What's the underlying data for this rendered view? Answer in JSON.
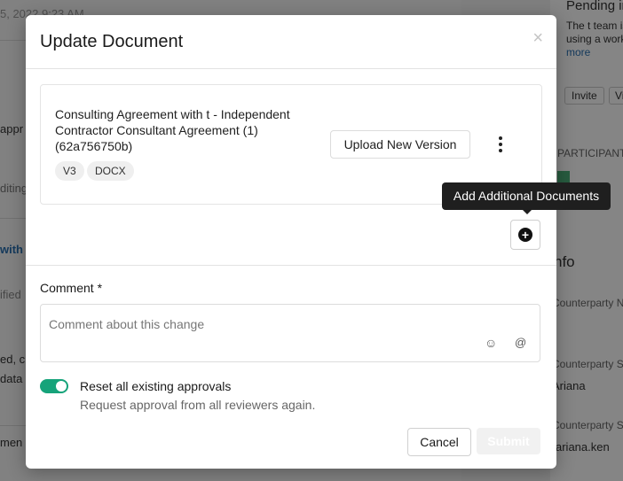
{
  "background": {
    "date_text": "5, 2022 9:23 AM",
    "left_snippets": [
      "appr",
      "diting",
      "with t",
      "ified",
      "ed, cl",
      "data",
      "men"
    ],
    "right_title": "Pending in",
    "right_desc_1": "The t team is",
    "right_desc_2": "using a work",
    "right_more": "more",
    "invite_label": "Invite",
    "view_label": "Vie",
    "participants_heading": "PARTICIPANT",
    "info_heading": "nfo",
    "counterparty_1": "Counterparty N",
    "counterparty_2": "Counterparty S",
    "counterparty_name": "Ariana",
    "counterparty_3": "Counterparty S",
    "counterparty_email": "ariana.ken"
  },
  "modal": {
    "title": "Update Document",
    "close_glyph": "×",
    "document": {
      "name": "Consulting Agreement with t - Independent Contractor Consultant Agreement (1) (62a756750b)",
      "tags": [
        "V3",
        "DOCX"
      ],
      "upload_label": "Upload New Version"
    },
    "add_tooltip": "Add Additional Documents",
    "add_glyph": "+",
    "comment": {
      "label": "Comment *",
      "placeholder": "Comment about this change",
      "emoji_glyph": "☺",
      "mention_glyph": "@"
    },
    "reset": {
      "label": "Reset all existing approvals",
      "sub": "Request approval from all reviewers again.",
      "enabled": true,
      "accent": "#16a37a"
    },
    "actions": {
      "cancel": "Cancel",
      "submit": "Submit"
    }
  }
}
